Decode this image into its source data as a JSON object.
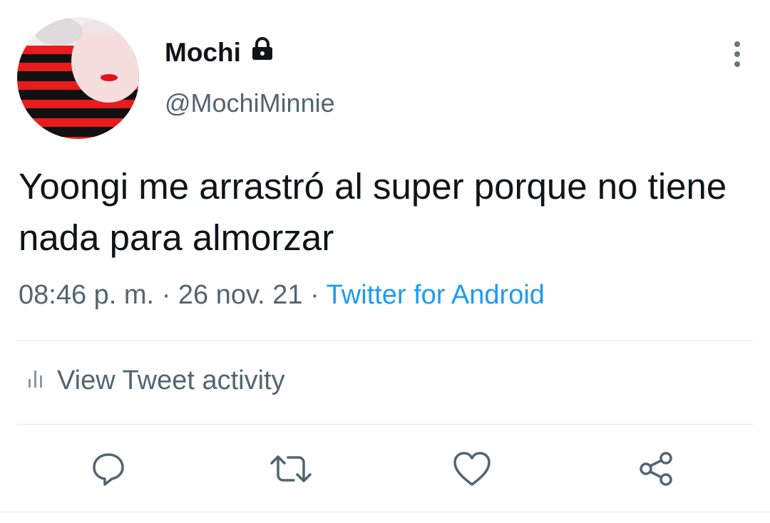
{
  "tweet": {
    "display_name": "Mochi",
    "handle": "@MochiMinnie",
    "text": "Yoongi me arrastró al super porque no tiene nada para almorzar",
    "time": "08:46 p. m.",
    "separator": "·",
    "date": "26 nov. 21",
    "source": "Twitter for Android",
    "protected_icon": "lock-icon"
  },
  "activity": {
    "label": "View Tweet activity",
    "icon": "bar-chart-icon"
  },
  "actions": [
    {
      "name": "reply",
      "icon": "reply-icon"
    },
    {
      "name": "retweet",
      "icon": "retweet-icon"
    },
    {
      "name": "like",
      "icon": "heart-icon"
    },
    {
      "name": "share",
      "icon": "share-icon"
    }
  ],
  "colors": {
    "text": "#0f1419",
    "muted": "#536471",
    "accent": "#1d9bf0",
    "divider": "#e6e6e6"
  }
}
